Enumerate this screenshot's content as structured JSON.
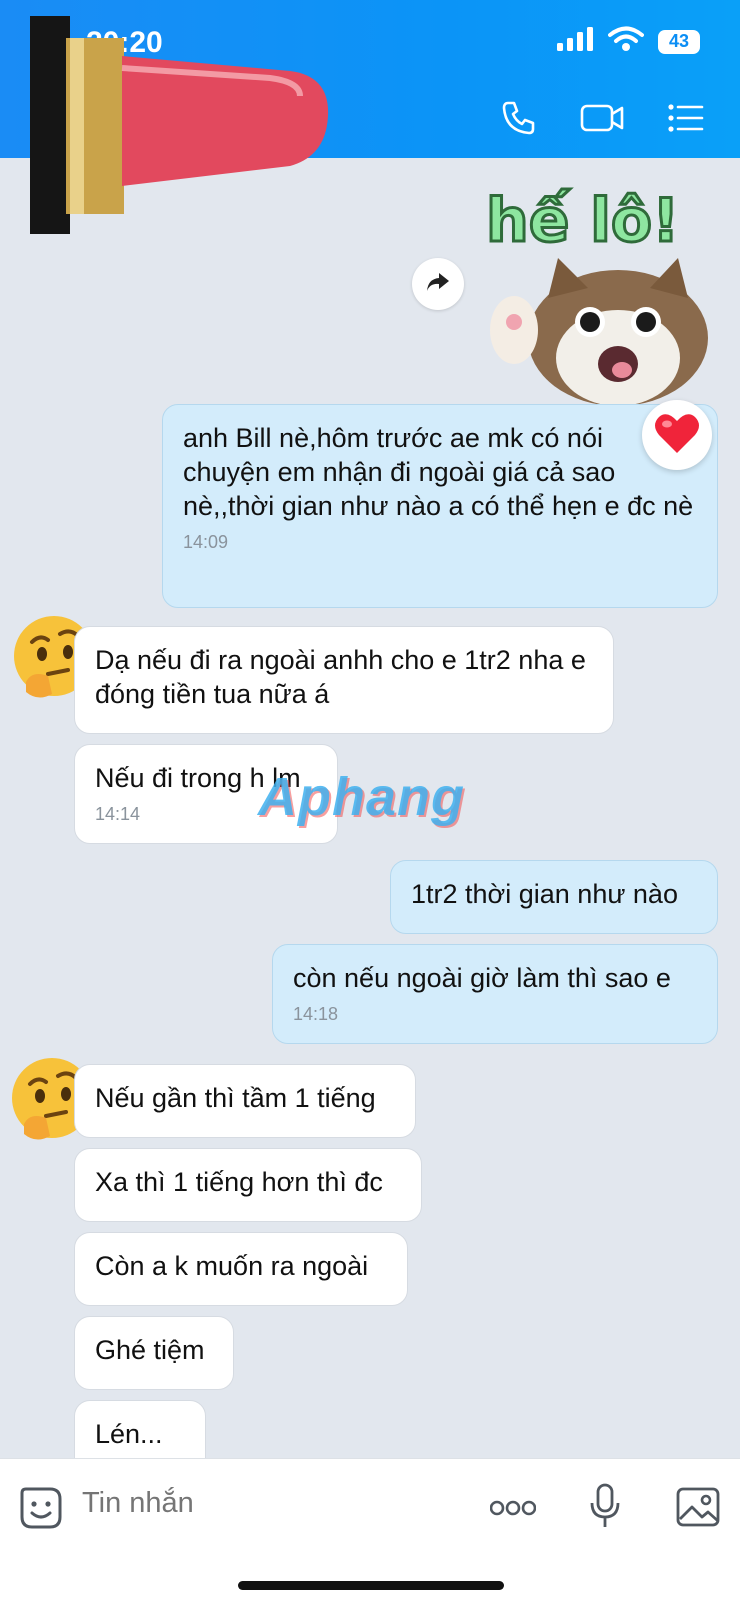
{
  "status": {
    "time": "20:20",
    "battery": "43"
  },
  "sticker": {
    "caption": "hế lô!"
  },
  "messages": {
    "m1": {
      "text": "anh Bill nè,hôm trước ae mk có nói chuyện em nhận đi ngoài giá cả sao nè,,thời gian như nào a có thể hẹn e đc nè",
      "time": "14:09"
    },
    "m2": {
      "text": "Dạ nếu đi ra ngoài anhh cho e 1tr2 nha e đóng tiền tua nữa á"
    },
    "m3": {
      "text": "Nếu đi trong h lm",
      "time": "14:14"
    },
    "m4": {
      "text": "1tr2 thời gian như nào"
    },
    "m5": {
      "text": "còn nếu ngoài giờ làm thì sao e",
      "time": "14:18"
    },
    "m6": {
      "text": "Nếu gần thì tầm 1 tiếng"
    },
    "m7": {
      "text": "Xa thì 1 tiếng hơn thì đc"
    },
    "m8": {
      "text": "Còn a k muốn ra ngoài"
    },
    "m9": {
      "text": "Ghé tiệm"
    },
    "m10": {
      "text": "Lén..."
    }
  },
  "watermark": "Aphang",
  "input": {
    "placeholder": "Tin nhắn"
  },
  "icons": {
    "phone": "phone-icon",
    "video": "video-icon",
    "menu": "list-menu-icon",
    "share": "share-forward-icon",
    "heart": "heart-icon",
    "sticker": "sticker-icon",
    "more": "more-dots-icon",
    "mic": "microphone-icon",
    "image": "image-icon"
  }
}
